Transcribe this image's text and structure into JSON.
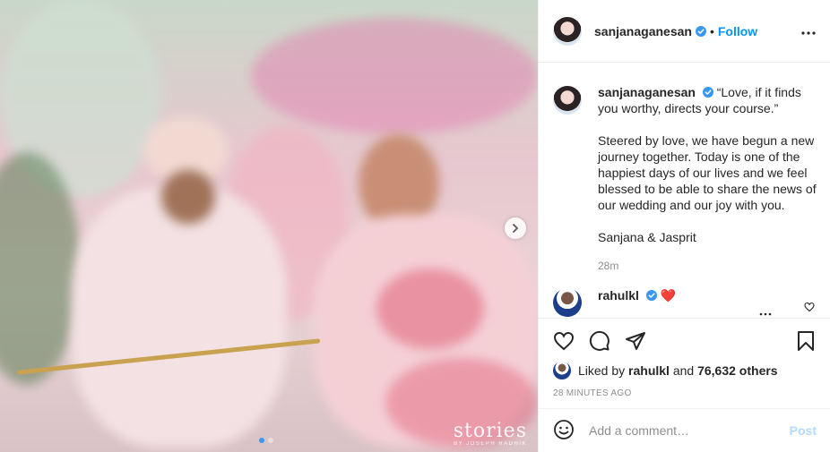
{
  "photo": {
    "watermark_main": "stories",
    "watermark_sub": "BY JOSEPH RADHIK",
    "slide_count": 2,
    "active_slide": 1
  },
  "header": {
    "username": "sanjanaganesan",
    "bullet": "•",
    "follow_label": "Follow",
    "more_label": "•••"
  },
  "caption": {
    "username": "sanjanaganesan",
    "quote": "“Love, if it finds you worthy, directs your course.”",
    "paragraph": "Steered by love, we have begun a new journey together. Today is one of the happiest days of our lives and we feel blessed to be able to share the news of our wedding and our joy with you.",
    "signature": "Sanjana & Jasprit",
    "time": "28m"
  },
  "comment": {
    "username": "rahulkl",
    "text": "❤️",
    "more_label": "•••"
  },
  "likes": {
    "prefix": "Liked by",
    "user": "rahulkl",
    "and": "and",
    "others": "76,632 others"
  },
  "posted_ago": "28 MINUTES AGO",
  "add_comment": {
    "placeholder": "Add a comment…",
    "post_label": "Post"
  },
  "colors": {
    "accent": "#0095f6",
    "verified": "#3897f0",
    "heart": "#ed4956",
    "muted": "#8e8e8e"
  },
  "icons": [
    "more-icon",
    "verified-icon",
    "chevron-right-icon",
    "heart-icon",
    "comment-icon",
    "share-icon",
    "bookmark-icon",
    "emoji-icon"
  ]
}
